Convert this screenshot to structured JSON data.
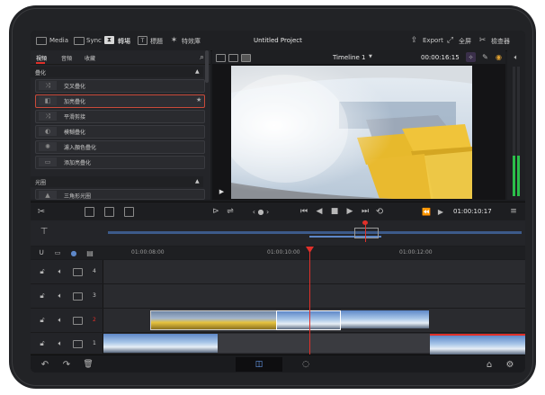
{
  "topbar": {
    "media": "Media",
    "sync": "Sync",
    "transitions": "轉場",
    "titles": "標題",
    "effects": "特效庫",
    "project_title": "Untitled Project",
    "export": "Export",
    "fullscreen": "全屏",
    "inspector": "檢查器"
  },
  "library": {
    "tabs": [
      "視頻",
      "音頻",
      "收藏"
    ],
    "sections": [
      {
        "title": "疊化",
        "items": [
          "交叉疊化",
          "加亮疊化",
          "平滑剪接",
          "模糊疊化",
          "濾入顏色疊化",
          "添加亮疊化"
        ]
      },
      {
        "title": "光圈",
        "items": [
          "三角形光圈"
        ]
      }
    ],
    "selected_item": "加亮疊化"
  },
  "viewer": {
    "timeline_name": "Timeline 1",
    "timecode": "00:00:16:15"
  },
  "toolbar": {
    "timecode": "01:00:10:17"
  },
  "ruler": {
    "labels": [
      "01:00:08:00",
      "01:00:10:00",
      "01:00:12:00"
    ]
  },
  "tracks": [
    {
      "number": "4"
    },
    {
      "number": "3"
    },
    {
      "number": "2"
    },
    {
      "number": "1"
    }
  ],
  "colors": {
    "accent_red": "#e0302a",
    "selection_red": "#c94a3a",
    "playhead": "#e0302a",
    "meter_green": "#2bbf4a"
  }
}
